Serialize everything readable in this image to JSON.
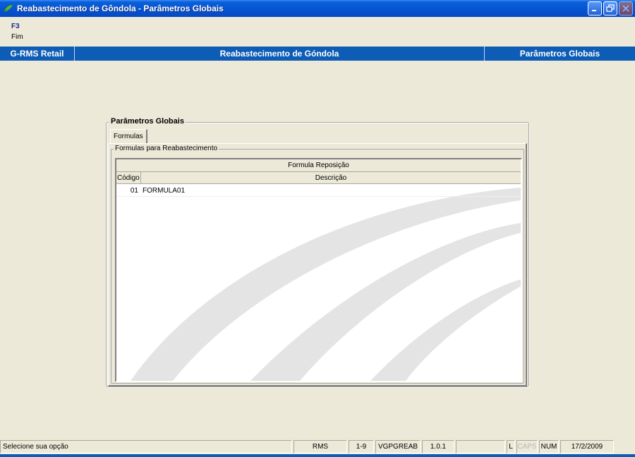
{
  "window": {
    "title": "Reabastecimento de Gôndola - Parâmetros Globais",
    "icon": "app-leaf-icon"
  },
  "function_keys": [
    {
      "key": "F3",
      "label": "Fim"
    }
  ],
  "header": {
    "left": "G-RMS Retail",
    "center": "Reabastecimento de Góndola",
    "right": "Parâmetros Globais"
  },
  "group": {
    "title": "Parâmetros Globais",
    "tab": "Formulas",
    "inner_title": "Formulas para Reabastecimento",
    "grid": {
      "band_header": "Formula Reposição",
      "columns": [
        "Código",
        "Descrição"
      ],
      "rows": [
        {
          "codigo": "01",
          "descricao": "FORMULA01"
        }
      ]
    }
  },
  "statusbar": {
    "message": "Selecione sua opção",
    "system": "RMS",
    "range": "1-9",
    "program": "VGPGREAB",
    "version": "1.0.1",
    "empty": "",
    "l": "L",
    "caps": "CAPS",
    "num": "NUM",
    "date": "17/2/2009"
  },
  "colors": {
    "title_bar": "#0553d3",
    "header_band": "#0d5cb5",
    "background": "#ece9d8",
    "fkey_text": "#1b2a8c"
  }
}
